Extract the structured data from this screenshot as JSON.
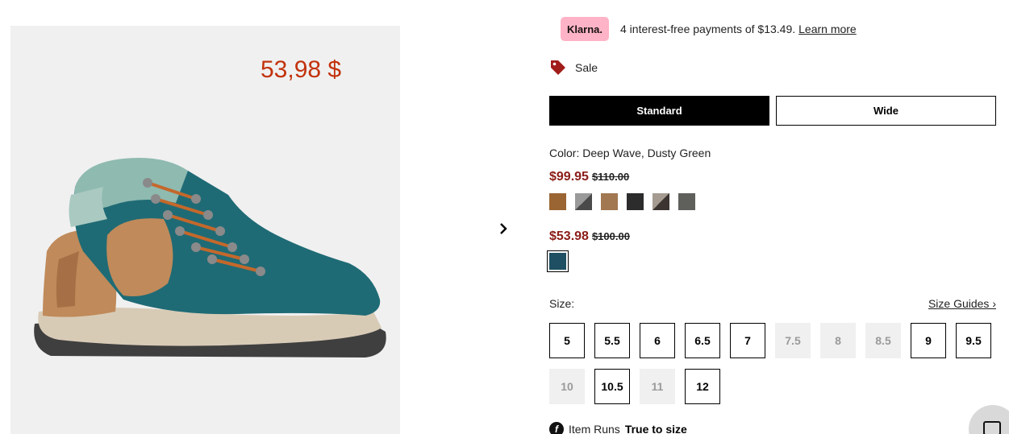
{
  "image_panel": {
    "price": "53,98 $"
  },
  "carousel": {
    "next_icon": "chevron-right-icon"
  },
  "klarna": {
    "badge": "Klarna.",
    "text": "4 interest-free payments of $13.49.",
    "link": "Learn more",
    "badge_color": "#ffb3c7"
  },
  "sale": {
    "icon": "tag-icon",
    "label": "Sale",
    "icon_color": "#a11d1a"
  },
  "width_options": [
    {
      "label": "Standard",
      "selected": true
    },
    {
      "label": "Wide",
      "selected": false
    }
  ],
  "color": {
    "label": "Color: Deep Wave, Dusty Green"
  },
  "price_groups": [
    {
      "sale_price": "$99.95",
      "original_price": "$110.00",
      "swatches": [
        {
          "name": "swatch-brown",
          "color": "#9a6532"
        },
        {
          "name": "swatch-grey-black",
          "color": "#4a4a4a",
          "secondary": "#9a9a9a"
        },
        {
          "name": "swatch-tan",
          "color": "#a27852"
        },
        {
          "name": "swatch-black",
          "color": "#2c2c2c"
        },
        {
          "name": "swatch-dark-brown",
          "color": "#3b3430",
          "secondary": "#a59b91"
        },
        {
          "name": "swatch-grey",
          "color": "#5f5f5c"
        }
      ]
    },
    {
      "sale_price": "$53.98",
      "original_price": "$100.00",
      "swatches": [
        {
          "name": "swatch-deep-wave",
          "color": "#1e4f62",
          "selected": true
        }
      ]
    }
  ],
  "size": {
    "label": "Size:",
    "guides_link": "Size Guides ›",
    "options": [
      {
        "label": "5",
        "available": true
      },
      {
        "label": "5.5",
        "available": true
      },
      {
        "label": "6",
        "available": true
      },
      {
        "label": "6.5",
        "available": true
      },
      {
        "label": "7",
        "available": true
      },
      {
        "label": "7.5",
        "available": false
      },
      {
        "label": "8",
        "available": false
      },
      {
        "label": "8.5",
        "available": false
      },
      {
        "label": "9",
        "available": true
      },
      {
        "label": "9.5",
        "available": true
      },
      {
        "label": "10",
        "available": false
      },
      {
        "label": "10.5",
        "available": true
      },
      {
        "label": "11",
        "available": false
      },
      {
        "label": "12",
        "available": true
      }
    ]
  },
  "fit": {
    "icon": "info-icon",
    "label": "Item Runs",
    "value": "True to size"
  },
  "chat": {
    "icon": "chat-icon"
  },
  "colors": {
    "price_overlay": "#c2320c",
    "sale_price": "#8a1c17"
  }
}
